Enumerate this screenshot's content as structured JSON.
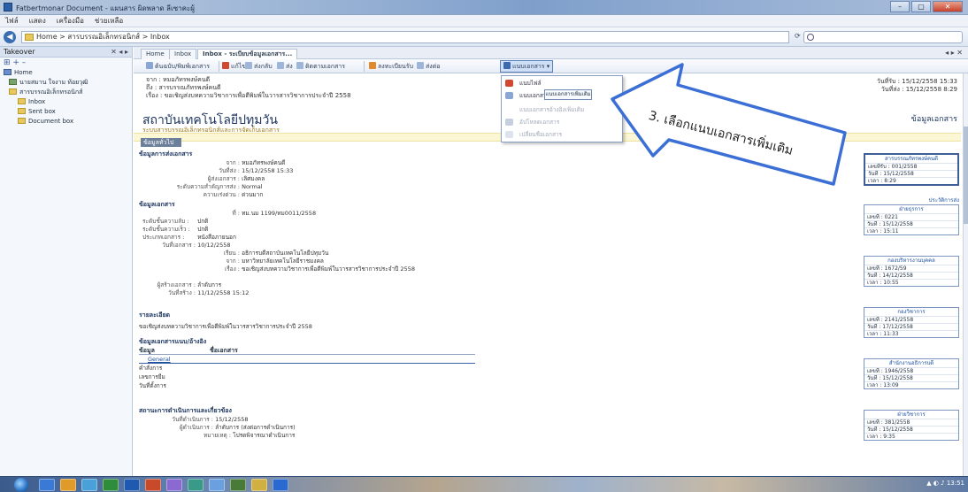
{
  "window": {
    "title": "Fatbertmonar Document - แผนสาร ผิดพลาด ลีเซาคะผู้",
    "btn_min": "–",
    "btn_max": "▢",
    "btn_close": "✕"
  },
  "menu": [
    "ไฟล์",
    "แสดง",
    "เครื่องมือ",
    "ช่วยเหลือ",
    "ช่วยเหลือ"
  ],
  "address": {
    "back_glyph": "◀",
    "path": "Home > สารบรรณอิเล็กทรอนิกส์ > Inbox",
    "refresh_glyph": "⟳",
    "search_placeholder": ""
  },
  "sidebar": {
    "header": "Takeover",
    "header_ctrl": "✕ ◂ ▸",
    "tools": "⊞  +  –",
    "items": [
      {
        "label": "Home",
        "icon": "home"
      },
      {
        "label": "นายสมาน ใจงาม ท้อยวุฒิ",
        "icon": "user"
      },
      {
        "label": "สารบรรณอิเล็กทรอนิกส์",
        "icon": "folder"
      },
      {
        "label": "Inbox",
        "icon": "folder"
      },
      {
        "label": "Sent box",
        "icon": "folder"
      },
      {
        "label": "Document box",
        "icon": "folder"
      }
    ]
  },
  "tabs": {
    "items": [
      "Home",
      "Inbox",
      "Inbox - ระเบียบข้อมูลเอกสาร..."
    ],
    "ctrl": "◂ ▸ ✕"
  },
  "toolbar": {
    "new_doc": "ต้นฉบับ/พิมพ์เอกสาร",
    "edit": "แก้ไข",
    "send_back": "ส่งกลับ",
    "send": "ส่ง",
    "track": "ติดตามเอกสาร",
    "register": "ลงทะเบียนรับ",
    "forward": "ส่งต่อ",
    "attach": "แนบเอกสาร"
  },
  "header": {
    "from": "จาก : หมอภัทรพงษ์คนดี",
    "to": "ถึง : สารบรรณภัทรพงษ์คนดี",
    "subject": "เรื่อง : ขอเชิญส่งบทความวิชาการเพื่อตีพิมพ์ในวารสารวิชาการประจำปี 2558",
    "received": "วันที่รับ : 15/12/2558 15:33",
    "sent": "วันที่ส่ง : 15/12/2558 8:29"
  },
  "org": {
    "title": "สถาบันเทคโนโลยีปทุมวัน",
    "subtitle": "ระบบสารบรรณอิเล็กทรอนิกส์และการจัดเก็บเอกสาร",
    "doc_label": "ข้อมูลเอกสาร",
    "doc_tab": "ข้อมูลทั่วไป"
  },
  "doc": {
    "sec_send": "ข้อมูลการส่งเอกสาร",
    "fields_send": [
      {
        "k": "จาก :",
        "v": "หมอภัทรพงษ์คนดี"
      },
      {
        "k": "วันที่ส่ง :",
        "v": "15/12/2558 15:33"
      },
      {
        "k": "ผู้ส่งเอกสาร :",
        "v": "เลิศมงคล"
      },
      {
        "k": "ระดับความสำคัญการส่ง :",
        "v": "Normal"
      },
      {
        "k": "ความเร่งด่วน :",
        "v": "ด่วนมาก"
      }
    ],
    "sec_doc": "ข้อมูลเอกสาร",
    "fields_doc": [
      {
        "k": "ที่ :",
        "v": "ทม.นม 1199/ทม0011/2558"
      },
      {
        "k": "ระดับชั้นความลับ :",
        "v": "ปกติ"
      },
      {
        "k": "ระดับชั้นความเร็ว :",
        "v": "ปกติ"
      },
      {
        "k": "ประเภทเอกสาร :",
        "v": "หนังสือภายนอก"
      },
      {
        "k": "วันที่เอกสาร :",
        "v": "10/12/2558"
      },
      {
        "k": "เรียน :",
        "v": "อธิการบดีสถาบันเทคโนโลยีปทุมวัน"
      },
      {
        "k": "จาก :",
        "v": "มหาวิทยาลัยเทคโนโลยีราชมงคล"
      },
      {
        "k": "เรื่อง :",
        "v": "ขอเชิญส่งบทความวิชาการเพื่อตีพิมพ์ในวารสารวิชาการประจำปี 2558"
      }
    ],
    "fields_create": [
      {
        "k": "ผู้สร้างเอกสาร :",
        "v": "ลำดับการ"
      },
      {
        "k": "วันที่สร้าง :",
        "v": "11/12/2558 15:12"
      }
    ],
    "sec_detail": "รายละเอียด",
    "detail_text": "ขอเชิญส่งบทความวิชาการเพื่อตีพิมพ์ในวารสารวิชาการประจำปี 2558",
    "sec_attach": "ข้อมูลเอกสารแนบ/อ้างอิง",
    "attach_col1": "ข้อมูล",
    "attach_col2": "ชื่อเอกสาร",
    "attach_rows": [
      "General",
      "คำสั่งการ",
      "เลขการยืม",
      "วันที่ตั้งการ"
    ],
    "sec_process": "สถานะการดำเนินการและเกี่ยวข้อง",
    "process_rows": [
      {
        "k": "วันที่ดำเนินการ :",
        "v": "15/12/2558"
      },
      {
        "k": "ผู้ดำเนินการ :",
        "v": "ลำดับการ (ส่งต่อการดำเนินการ)"
      },
      {
        "k": "หมายเหตุ :",
        "v": "โปรดพิจารณาดำเนินการ"
      }
    ]
  },
  "right_cards": [
    {
      "head": "สารบรรณภัทรพงษ์คนดี",
      "rows": [
        "เลขที่รับ : 001/2558",
        "วันที่ : 15/12/2558",
        "เวลา : 8:29"
      ]
    },
    {
      "head": "ฝ่ายธุรการ",
      "rows": [
        "เลขที่ : 0221",
        "วันที่ : 15/12/2558",
        "เวลา : 15:11"
      ]
    },
    {
      "head": "กองบริหารงานบุคคล",
      "rows": [
        "เลขที่ : 1672/59",
        "วันที่ : 14/12/2558",
        "เวลา : 10:55"
      ]
    },
    {
      "head": "กองวิชาการ",
      "rows": [
        "เลขที่ : 2141/2558",
        "วันที่ : 17/12/2558",
        "เวลา : 11:33"
      ]
    },
    {
      "head": "สำนักงานอธิการบดี",
      "rows": [
        "เลขที่ : 1946/2558",
        "วันที่ : 15/12/2558",
        "เวลา : 13:09"
      ]
    },
    {
      "head": "ฝ่ายวิชาการ",
      "rows": [
        "เลขที่ : 381/2558",
        "วันที่ : 15/12/2558",
        "เวลา : 9:35"
      ]
    }
  ],
  "right_link": "ประวัติการส่ง",
  "dropdown": {
    "items": [
      "แนบไฟล์",
      "แนบเอกสารอิเล็กทรอนิกส์",
      "แนบเอกสารอ้างอิงเพิ่มเติม",
      "อัปโหลดเอกสาร",
      "เปลี่ยนชื่อเอกสาร"
    ],
    "sub_label": "แนบเอกสารเพิ่มเติม"
  },
  "callout": {
    "text": "3. เลือกแนบเอกสารเพิ่มเติม"
  },
  "taskbar": {
    "tray": "▲ ◐ ♪  13:51"
  }
}
